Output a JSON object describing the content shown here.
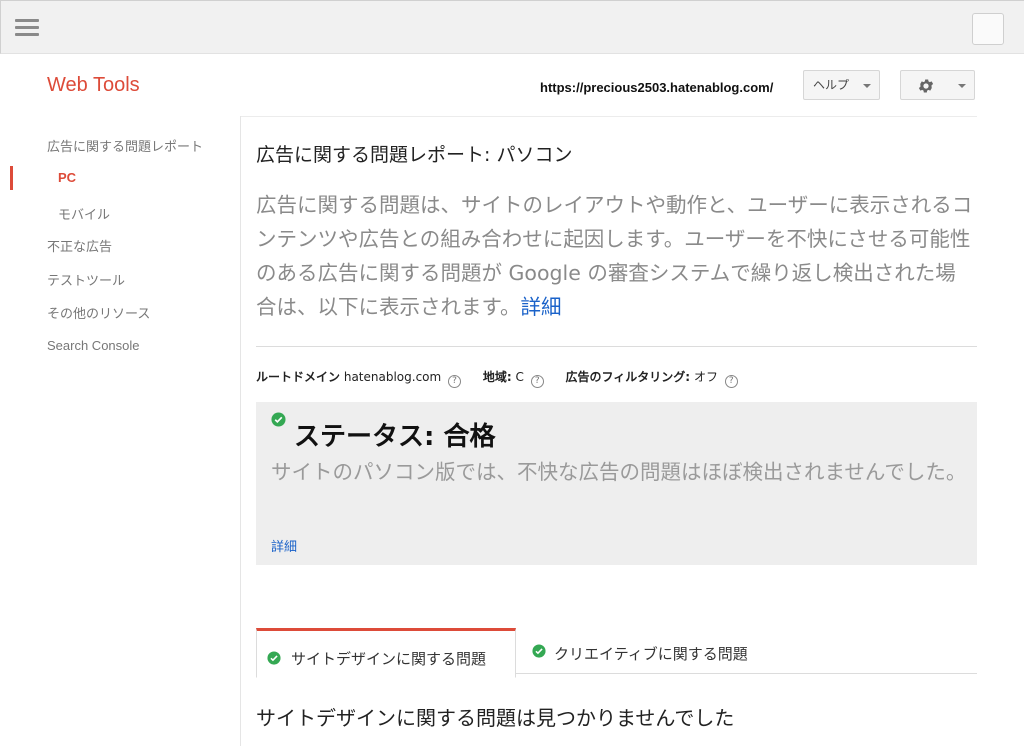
{
  "app": {
    "title": "Web Tools"
  },
  "header": {
    "site_url": "https://precious2503.hatenablog.com/",
    "help_label": "ヘルプ",
    "accent_color": "#dd4b39"
  },
  "sidebar": {
    "items": [
      {
        "label": "広告に関する問題レポート"
      },
      {
        "label": "PC"
      },
      {
        "label": "モバイル"
      },
      {
        "label": "不正な広告"
      },
      {
        "label": "テストツール"
      },
      {
        "label": "その他のリソース"
      },
      {
        "label": "Search Console"
      }
    ]
  },
  "main": {
    "page_title": "広告に関する問題レポート: パソコン",
    "intro_text": "広告に関する問題は、サイトのレイアウトや動作と、ユーザーに表示されるコンテンツや広告との組み合わせに起因します。ユーザーを不快にさせる可能性のある広告に関する問題が Google の審査システムで繰り返し検出された場合は、以下に表示されます。",
    "intro_link": "詳細",
    "meta": {
      "root_domain_label": "ルートドメイン",
      "root_domain_value": "hatenablog.com",
      "region_label": "地域:",
      "region_value": "C",
      "filtering_label": "広告のフィルタリング:",
      "filtering_value": "オフ",
      "help_glyph": "?"
    },
    "status": {
      "title": "ステータス: 合格",
      "description": "サイトのパソコン版では、不快な広告の問題はほぼ検出されませんでした。",
      "link": "詳細",
      "status_color": "#34a853"
    },
    "tabs": [
      {
        "label": "サイトデザインに関する問題"
      },
      {
        "label": "クリエイティブに関する問題"
      }
    ],
    "result_title": "サイトデザインに関する問題は見つかりませんでした"
  }
}
